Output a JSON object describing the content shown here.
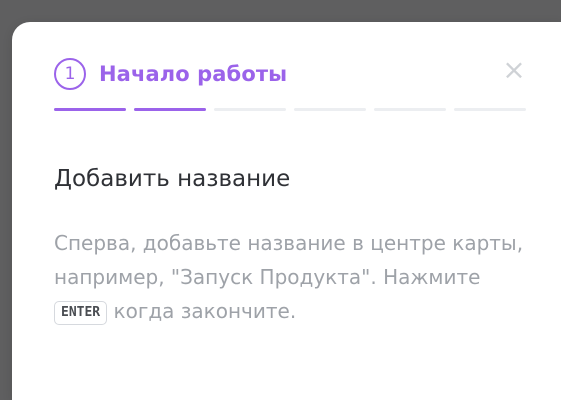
{
  "header": {
    "step_number": "1",
    "title": "Начало работы",
    "close_icon": "×"
  },
  "progress": {
    "total_steps": 6,
    "completed_steps": 2,
    "accent_color": "#9b63ea",
    "inactive_color": "#eceef1"
  },
  "content": {
    "heading": "Добавить название",
    "text_before": "Сперва, добавьте название в центре карты, например, \"Запуск Продукта\". Нажмите ",
    "key": "ENTER",
    "text_after": " когда закончите."
  }
}
